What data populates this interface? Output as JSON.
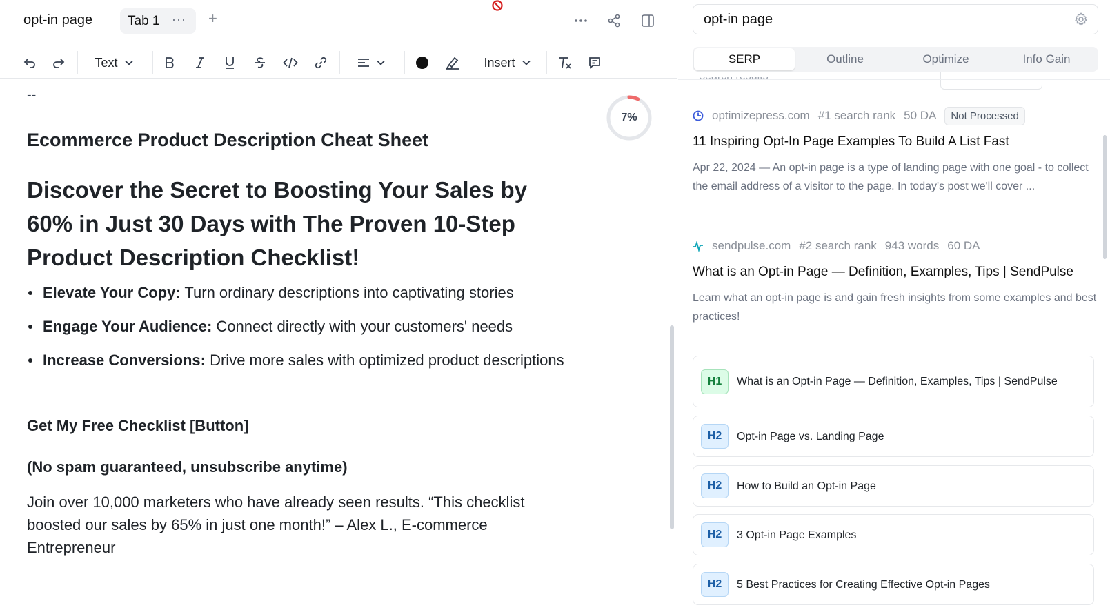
{
  "editor": {
    "doc_title": "opt-in page",
    "tab_label": "Tab 1",
    "tab_menu": "···",
    "add_tab": "+",
    "toolbar": {
      "text_style": "Text",
      "insert": "Insert",
      "text_color": "#111111"
    },
    "content": {
      "dashes": "--",
      "score": "7%",
      "score_value": 0.07,
      "subheading": "Ecommerce Product Description Cheat Sheet",
      "headline": "Discover the Secret to Boosting Your Sales by 60% in Just 30 Days with The Proven 10-Step Product Description Checklist!",
      "bullets": [
        {
          "bold": "Elevate Your Copy:",
          "text": " Turn ordinary descriptions into captivating stories"
        },
        {
          "bold": "Engage Your Audience:",
          "text": " Connect directly with your customers' needs"
        },
        {
          "bold": "Increase Conversions:",
          "text": " Drive more sales with optimized product descriptions"
        }
      ],
      "cta": "Get My Free Checklist [Button]",
      "nospam": "(No spam guaranteed, unsubscribe anytime)",
      "testimonial": "Join over 10,000 marketers who have already seen results. “This checklist boosted our sales by 65% in just one month!” – Alex L., E-commerce Entrepreneur"
    }
  },
  "sidebar": {
    "keyword": "opt-in page",
    "tabs": [
      "SERP",
      "Outline",
      "Optimize",
      "Info Gain"
    ],
    "active_tab": "SERP",
    "partial_label": "• search results",
    "results": [
      {
        "domain": "optimizepress.com",
        "rank": "#1 search rank",
        "words": "",
        "da": "50 DA",
        "badge": "Not Processed",
        "title": "11 Inspiring Opt-In Page Examples To Build A List Fast",
        "snippet": "Apr 22, 2024 — An opt-in page is a type of landing page with one goal - to collect the email address of a visitor to the page. In today's post we'll cover ...",
        "favicon_color": "#3b5bdb"
      },
      {
        "domain": "sendpulse.com",
        "rank": "#2 search rank",
        "words": "943 words",
        "da": "60 DA",
        "badge": "",
        "title": "What is an Opt-in Page — Definition, Examples, Tips | SendPulse",
        "snippet": "Learn what an opt-in page is and gain fresh insights from some examples and best practices!",
        "favicon_color": "#0ea5b7"
      }
    ],
    "headings": [
      {
        "level": "H1",
        "text": "What is an Opt-in Page — Definition, Examples, Tips | SendPulse"
      },
      {
        "level": "H2",
        "text": "Opt-in Page vs. Landing Page"
      },
      {
        "level": "H2",
        "text": "How to Build an Opt-in Page"
      },
      {
        "level": "H2",
        "text": "3 Opt-in Page Examples"
      },
      {
        "level": "H2",
        "text": "5 Best Practices for Creating Effective Opt-in Pages"
      }
    ]
  }
}
